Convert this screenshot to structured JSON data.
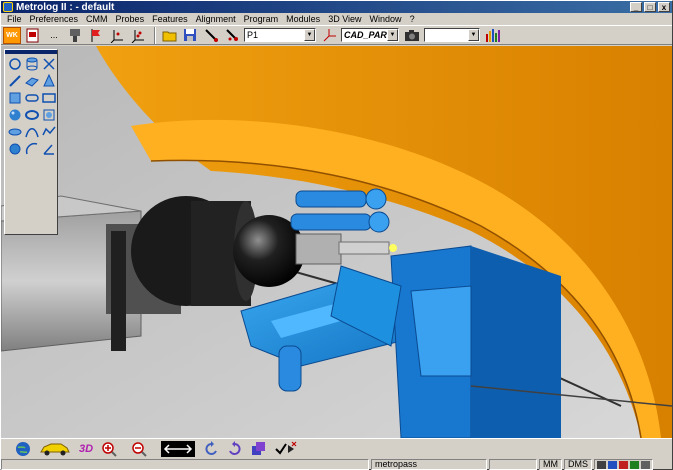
{
  "window": {
    "title": "Metrolog II : - default",
    "minimize": "_",
    "maximize": "□",
    "close": "x"
  },
  "menu": [
    "File",
    "Preferences",
    "CMM",
    "Probes",
    "Features",
    "Alignment",
    "Program",
    "Modules",
    "3D View",
    "Window",
    "?"
  ],
  "toolbar": {
    "wk_label": "WK",
    "ellipsis": "...",
    "probe_combo": "P1",
    "cad_combo": "CAD_PART",
    "empty_combo": ""
  },
  "status": {
    "user": "metropass",
    "units": "MM",
    "angle_format": "DMS"
  },
  "colors": {
    "fixture_blue": "#1e90e0",
    "cad_part_orange": "#f0a000",
    "title_bar": "#0a246a"
  },
  "palette_icons": [
    "circle-measure-icon",
    "cylinder-measure-icon",
    "point-icon",
    "line-icon",
    "plane-icon",
    "cone-icon",
    "square-icon",
    "slot-icon",
    "rectangle-icon",
    "sphere-icon",
    "torus-icon",
    "surface-icon",
    "ellipse-icon",
    "curve-icon",
    "profile-icon",
    "circle-2d-icon",
    "arc-icon",
    "angle-icon"
  ],
  "bottom_icons": [
    "globe-icon",
    "car-icon",
    "3d-view-icon",
    "zoom-in-icon",
    "zoom-out-icon",
    "zoom-fit-icon",
    "rotate-left-icon",
    "rotate-right-icon",
    "layers-icon",
    "check-play-icon"
  ],
  "bottom_labels": {
    "three_d": "3D"
  }
}
